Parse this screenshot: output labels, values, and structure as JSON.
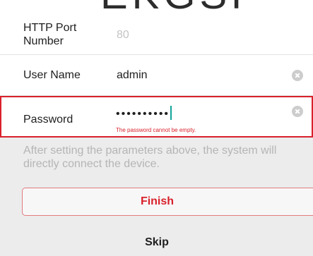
{
  "header": {
    "cut_title": "EKGSF"
  },
  "form": {
    "http_port": {
      "label": "HTTP Port Number",
      "value": "",
      "placeholder": "80"
    },
    "user_name": {
      "label": "User Name",
      "value": "admin"
    },
    "password": {
      "label": "Password",
      "masked_value": "••••••••••",
      "error": "The password cannot be empty."
    }
  },
  "hint": "After setting the parameters above, the system will directly connect the device.",
  "actions": {
    "finish_label": "Finish",
    "skip_label": "Skip"
  },
  "colors": {
    "accent": "#d9212b",
    "caret": "#11a39a",
    "hint": "#b5b5b5"
  },
  "icons": {
    "clear": "clear-icon"
  }
}
